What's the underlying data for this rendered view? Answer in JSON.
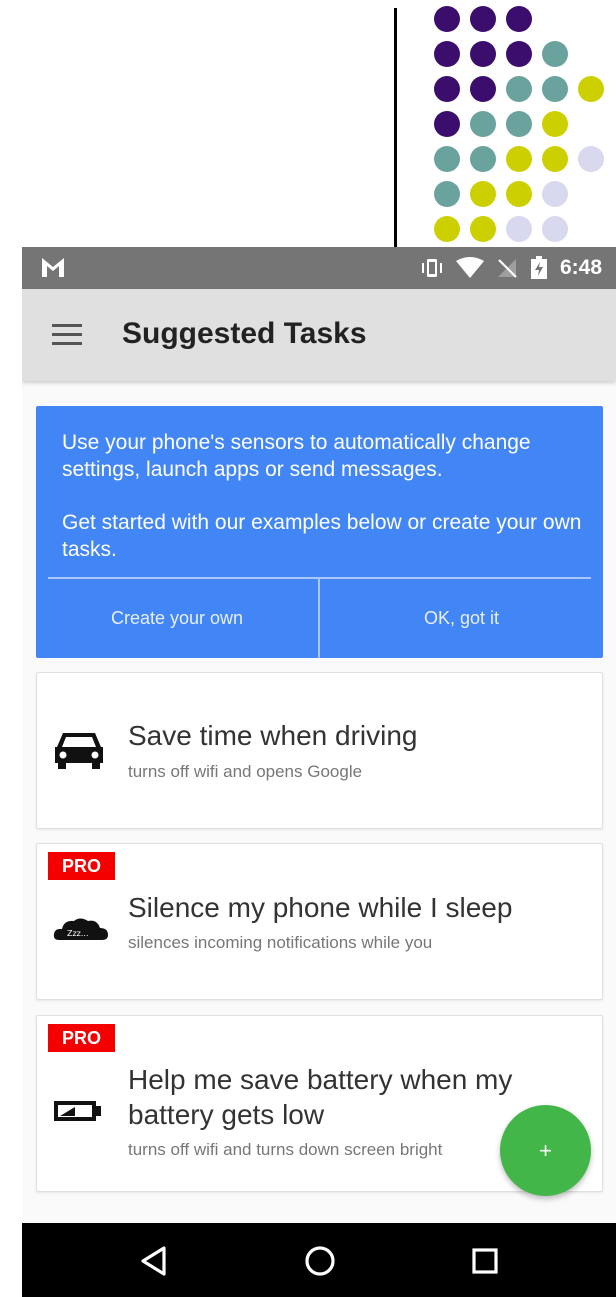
{
  "logo": {
    "colors": [
      "#3b0e6e",
      "#6aa39d",
      "#cdd000",
      "#d8d8ee"
    ]
  },
  "status_bar": {
    "time": "6:48",
    "icons": [
      "gmail-icon",
      "vibrate-icon",
      "wifi-icon",
      "no-sim-icon",
      "battery-charging-icon"
    ]
  },
  "app_bar": {
    "title": "Suggested Tasks",
    "menu_icon": "hamburger-menu-icon"
  },
  "banner": {
    "text_1": "Use your phone's sensors to automatically change settings, launch apps or send messages.",
    "text_2": "Get started with our examples below or create your own tasks.",
    "button_left": "Create your own",
    "button_right": "OK, got it",
    "color": "#4285f4"
  },
  "tasks": [
    {
      "pro": "",
      "title": "Save time when driving",
      "subtitle": "turns off wifi and opens Google",
      "icon": "car-icon"
    },
    {
      "pro": "PRO",
      "title": "Silence my phone while I sleep",
      "subtitle": "silences incoming notifications while you",
      "icon": "sleep-cloud-icon"
    },
    {
      "pro": "PRO",
      "title_line_1": "Help me save battery when my",
      "title_line_2": "battery gets low",
      "subtitle": "turns off wifi and turns down screen bright",
      "icon": "low-battery-icon"
    }
  ],
  "fab": {
    "label": "+",
    "color": "#43b649"
  },
  "nav_bar": {
    "icons": [
      "back-icon",
      "home-icon",
      "recents-icon"
    ]
  },
  "colors": {
    "status_bar": "#757575",
    "app_bar": "#e0e0e0",
    "pro_badge": "#f40000"
  }
}
